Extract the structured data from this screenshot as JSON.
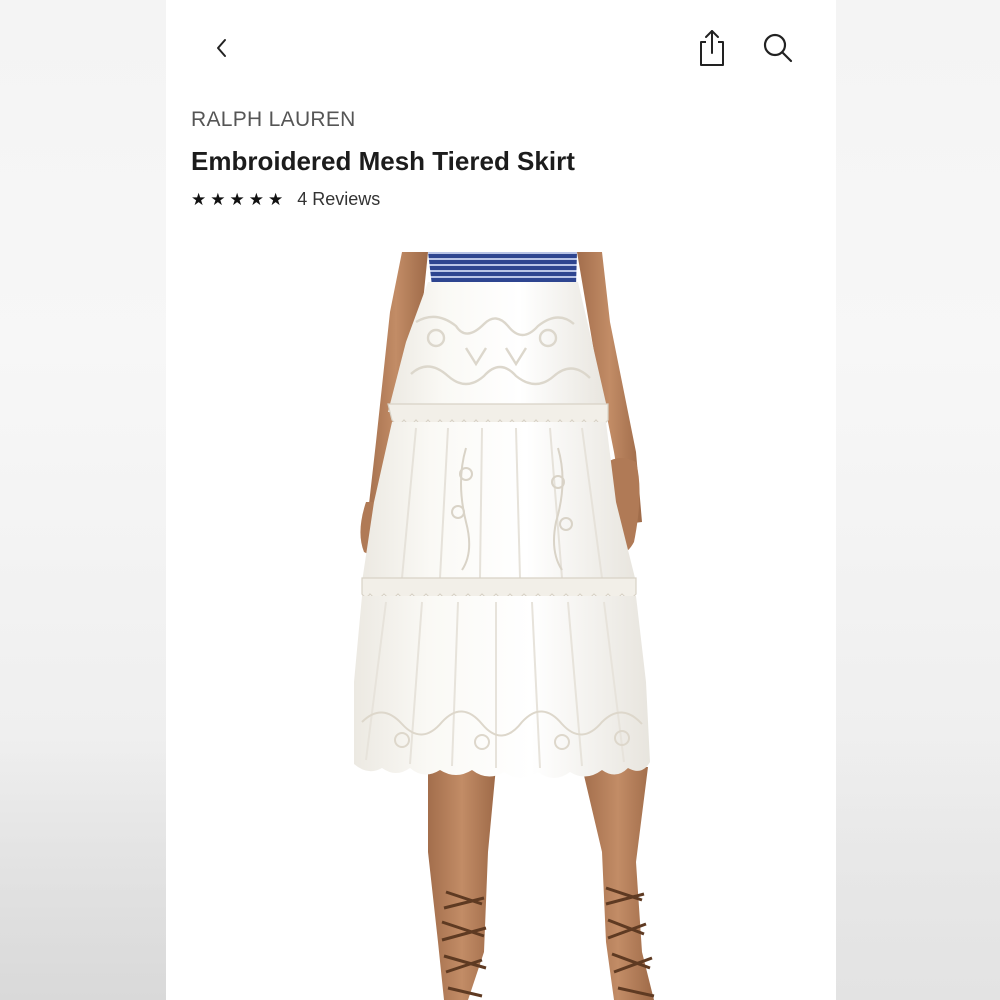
{
  "header": {
    "back_icon": "chevron-left-icon",
    "share_icon": "share-icon",
    "search_icon": "search-icon"
  },
  "product": {
    "brand": "RALPH LAUREN",
    "title": "Embroidered Mesh Tiered Skirt",
    "rating": 5,
    "stars": "★★★★★",
    "reviews_label": "4 Reviews",
    "image_alt": "Model wearing white embroidered mesh tiered skirt with striped top and lace-up sandals"
  },
  "colors": {
    "skirt": "#f8f6f1",
    "top_stripe": "#2a3f86",
    "skin": "#b9825c",
    "sandal": "#6b3f22",
    "text": "#1c1c1c"
  }
}
